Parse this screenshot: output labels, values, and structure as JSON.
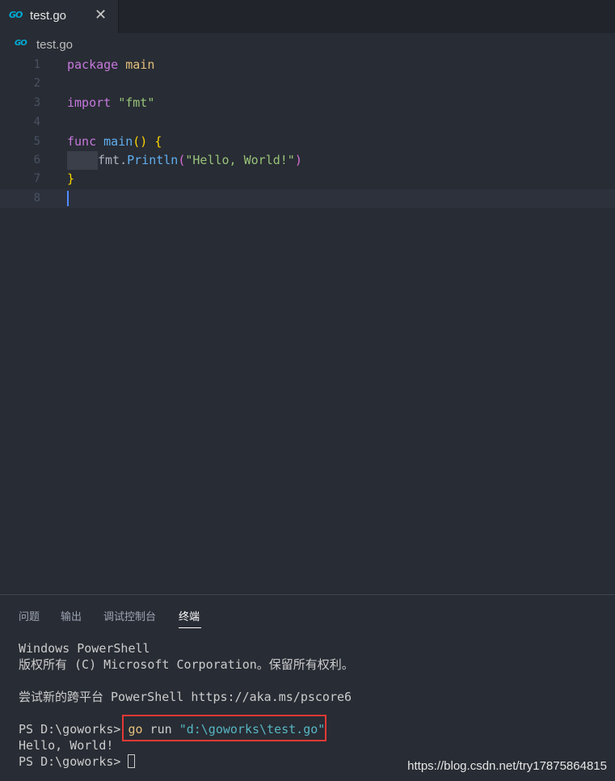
{
  "tab": {
    "icon": "GO",
    "label": "test.go",
    "close": "✕"
  },
  "breadcrumb": {
    "icon": "GO",
    "label": "test.go"
  },
  "editor": {
    "line_numbers": [
      "1",
      "2",
      "3",
      "4",
      "5",
      "6",
      "7",
      "8"
    ],
    "active_line": "8",
    "tokens": {
      "l1_kw": "package",
      "l1_name": "main",
      "l3_kw": "import",
      "l3_str": "\"fmt\"",
      "l5_kw": "func",
      "l5_fn": "main",
      "l5_parens": "()",
      "l5_brace": "{",
      "l6_pkg": "fmt",
      "l6_dot": ".",
      "l6_fn": "Println",
      "l6_open": "(",
      "l6_str": "\"Hello, World!\"",
      "l6_close": ")",
      "l7_brace": "}"
    }
  },
  "panel": {
    "tabs": [
      "问题",
      "输出",
      "调试控制台",
      "终端"
    ],
    "active_tab": "终端"
  },
  "terminal": {
    "line1": "Windows PowerShell",
    "line2": "版权所有 (C) Microsoft Corporation。保留所有权利。",
    "line3": "尝试新的跨平台 PowerShell https://aka.ms/pscore6",
    "prompt1": "PS D:\\goworks> ",
    "cmd_go": "go",
    "cmd_run": " run ",
    "cmd_path": "\"d:\\goworks\\test.go\"",
    "output": "Hello, World!",
    "prompt2": "PS D:\\goworks> "
  },
  "watermark": "https://blog.csdn.net/try17875864815",
  "colors": {
    "background": "#282c34",
    "keyword": "#c678dd",
    "function": "#61afef",
    "string": "#98c379",
    "highlight_box": "#e53935"
  }
}
